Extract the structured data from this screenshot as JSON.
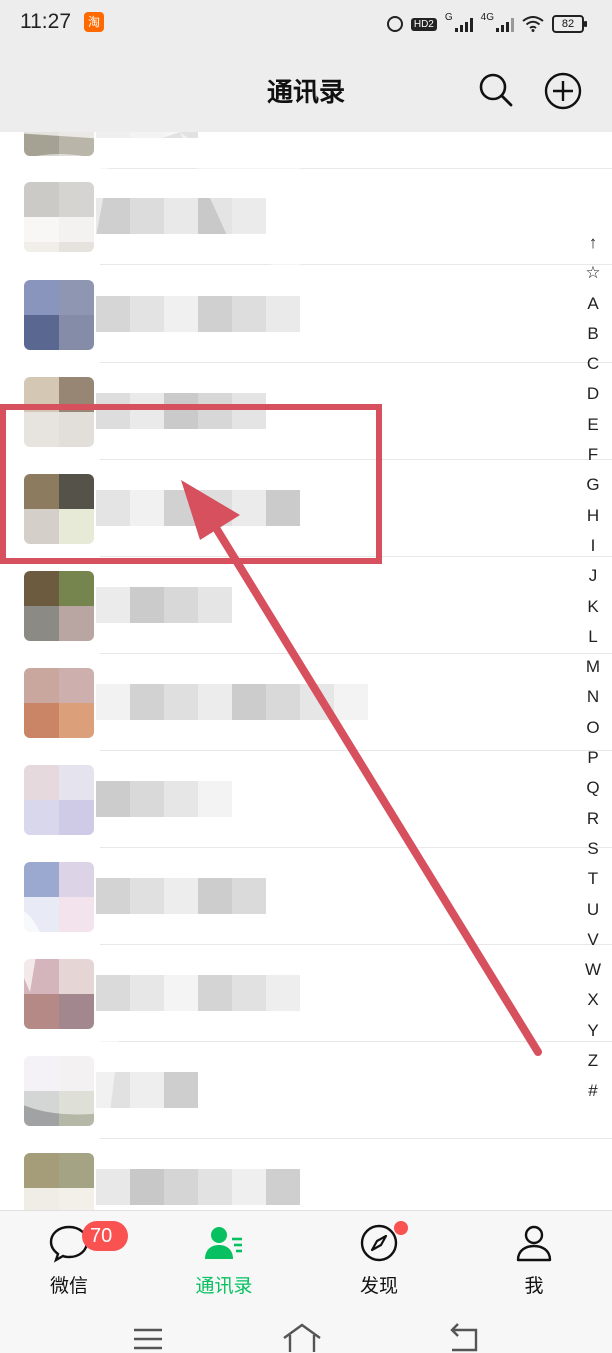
{
  "status_bar": {
    "time": "11:27",
    "hd_label": "HD2",
    "network_1": "G",
    "network_2": "4G",
    "battery": "82"
  },
  "header": {
    "title": "通讯录"
  },
  "contacts": {
    "row_count": 11
  },
  "index_bar": {
    "letters": [
      "↑",
      "☆",
      "A",
      "B",
      "C",
      "D",
      "E",
      "F",
      "G",
      "H",
      "I",
      "J",
      "K",
      "L",
      "M",
      "N",
      "O",
      "P",
      "Q",
      "R",
      "S",
      "T",
      "U",
      "V",
      "W",
      "X",
      "Y",
      "Z",
      "#"
    ]
  },
  "tabs": [
    {
      "label": "微信",
      "icon": "chat-icon",
      "badge": "70",
      "active": false
    },
    {
      "label": "通讯录",
      "icon": "contacts-icon",
      "active": true
    },
    {
      "label": "发现",
      "icon": "compass-icon",
      "dot": true,
      "active": false
    },
    {
      "label": "我",
      "icon": "person-icon",
      "active": false
    }
  ],
  "colors": {
    "accent": "#07c160",
    "annotation": "#d6505e",
    "badge": "#fa5151",
    "header_bg": "#ededed"
  }
}
